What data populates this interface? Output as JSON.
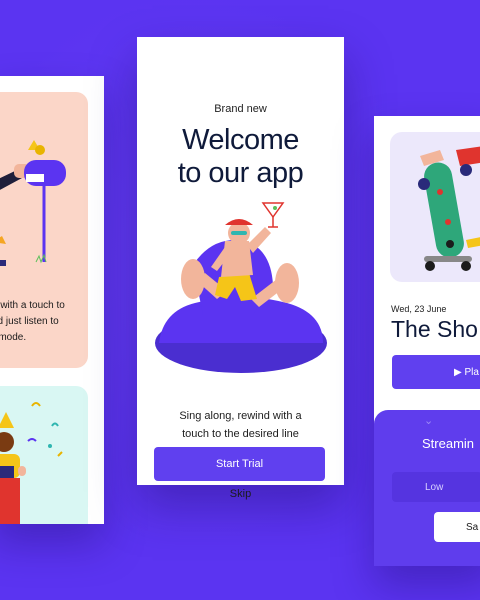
{
  "left_screen": {
    "description_lines": "d with a touch to\nnd just listen to\n\" mode."
  },
  "center_screen": {
    "eyebrow": "Brand new",
    "headline": "Welcome\nto our app",
    "tagline": "Sing along, rewind with a\ntouch to the desired line",
    "primary_button": "Start Trial",
    "secondary_link": "Skip"
  },
  "right_screen": {
    "date": "Wed, 23 June",
    "title": "The Sho",
    "play_button": "▶ Pla",
    "sheet": {
      "title": "Streamin",
      "option_low": "Low",
      "save_button": "Sa"
    }
  },
  "colors": {
    "background": "#5b34f1",
    "accent": "#6040ef",
    "card_peach": "#fbd6c8",
    "card_mint": "#d9f7f3",
    "card_lavender": "#ece8fb"
  }
}
